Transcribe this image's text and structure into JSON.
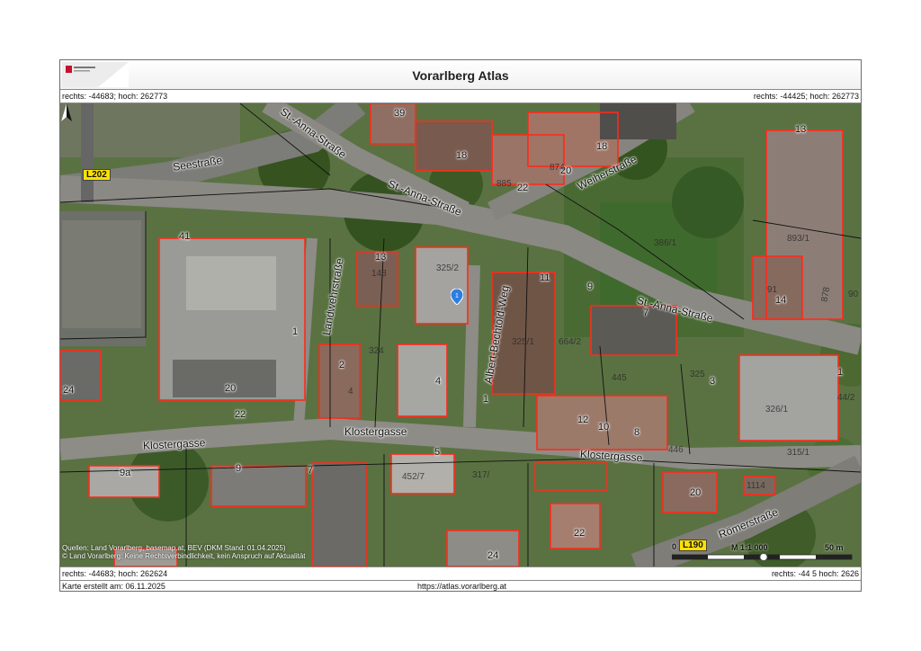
{
  "header": {
    "title": "Vorarlberg Atlas"
  },
  "coords": {
    "top_left": "rechts: -44683; hoch: 262773",
    "top_right": "rechts: -44425; hoch: 262773",
    "bottom_left": "rechts: -44683; hoch: 262624",
    "bottom_right": "rechts: -44 5 hoch: 2626"
  },
  "footer": {
    "created": "Karte erstellt am: 06.11.2025",
    "url": "https://atlas.vorarlberg.at"
  },
  "map": {
    "sources": "Quellen: Land Vorarlberg, basemap.at, BEV (DKM Stand: 01.04.2025)",
    "disclaimer": "© Land Vorarlberg: Keine Rechtsverbindlichkeit, kein Anspruch auf Aktualität",
    "scale": {
      "zero": "0",
      "ratio": "M 1:1 000",
      "end": "50 m"
    },
    "road_shields": [
      "L202",
      "L190"
    ],
    "streets": [
      "Seestraße",
      "St.-Anna-Straße",
      "St.-Anna-Straße",
      "Weiherstraße",
      "St.-Anna-Straße",
      "Landwehrstraße",
      "Albert-Bechtold-Weg",
      "Klostergasse",
      "Klostergasse",
      "Klostergasse",
      "Römerstraße"
    ],
    "house_numbers": [
      "39",
      "18",
      "18",
      "20",
      "22",
      "13",
      "41",
      "13",
      "11",
      "9",
      "7",
      "14",
      "1",
      "2",
      "4",
      "1",
      "3",
      "1",
      "24",
      "20",
      "22",
      "12",
      "10",
      "8",
      "9a",
      "9",
      "7",
      "5",
      "20",
      "22",
      "24"
    ],
    "parcels": [
      "874",
      "885",
      "325/2",
      "148",
      "325/1",
      "664/2",
      "445",
      "325",
      "324",
      "893/1",
      "91",
      "90",
      "878",
      "452/7",
      "317/",
      "446",
      "315/1",
      "1114",
      "44/2",
      "326/1",
      "386/1",
      "4"
    ]
  }
}
